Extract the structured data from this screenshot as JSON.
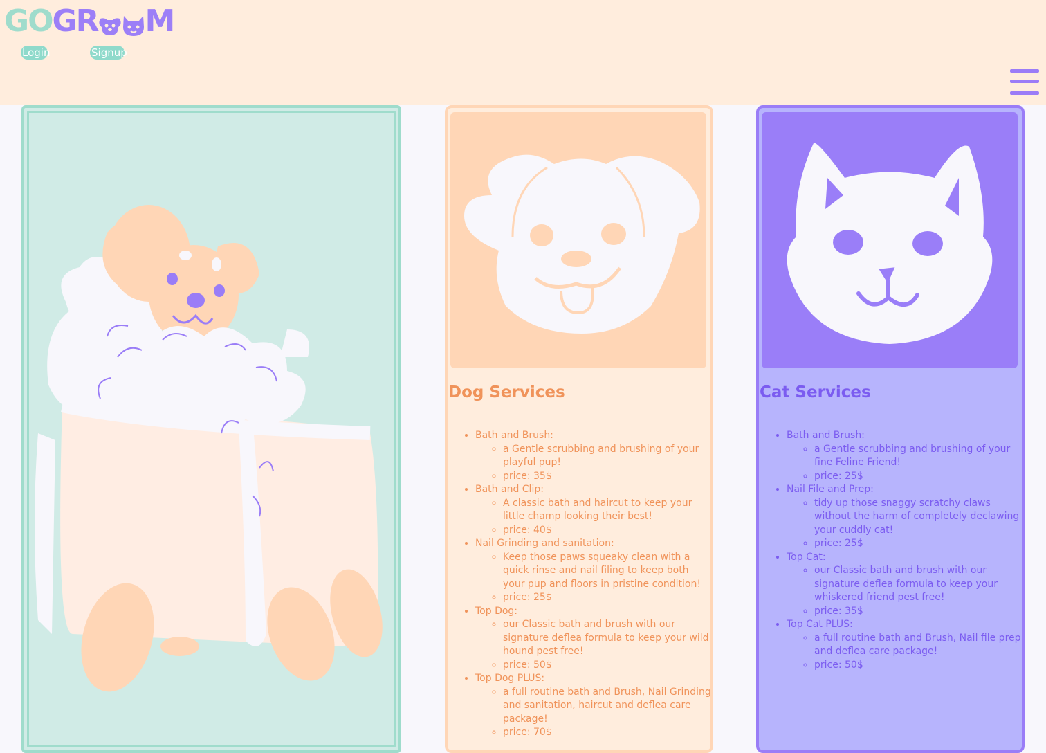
{
  "header": {
    "logo": {
      "part1": "GO",
      "part2": "GR",
      "part3": "M",
      "text": "GOGROOM"
    },
    "login_label": "Login",
    "signup_label": "Signup"
  },
  "dog": {
    "title": "Dog Services",
    "services": [
      {
        "name": "Bath and Brush:",
        "details": [
          "a Gentle scrubbing and brushing of your playful pup!",
          "price: 35$"
        ]
      },
      {
        "name": "Bath and Clip:",
        "details": [
          "A classic bath and haircut to keep your little champ looking their best!",
          "price: 40$"
        ]
      },
      {
        "name": "Nail Grinding and sanitation:",
        "details": [
          "Keep those paws squeaky clean with a quick rinse and nail filing to keep both your pup and floors in pristine condition!",
          "price: 25$"
        ]
      },
      {
        "name": "Top Dog:",
        "details": [
          "our Classic bath and brush with our signature deflea formula to keep your wild hound pest free!",
          "price: 50$"
        ]
      },
      {
        "name": "Top Dog PLUS:",
        "details": [
          "a full routine bath and Brush, Nail Grinding and sanitation, haircut and deflea care package!",
          "price: 70$"
        ]
      }
    ]
  },
  "cat": {
    "title": "Cat Services",
    "services": [
      {
        "name": "Bath and Brush:",
        "details": [
          "a Gentle scrubbing and brushing of your fine Feline Friend!",
          "price: 25$"
        ]
      },
      {
        "name": "Nail File and Prep:",
        "details": [
          "tidy up those snaggy scratchy claws without the harm of completely declawing your cuddly cat!",
          "price: 25$"
        ]
      },
      {
        "name": "Top Cat:",
        "details": [
          "our Classic bath and brush with our signature deflea formula to keep your whiskered friend pest free!",
          "price: 35$"
        ]
      },
      {
        "name": "Top Cat PLUS:",
        "details": [
          "a full routine bath and Brush, Nail file prep and deflea care package!",
          "price: 50$"
        ]
      }
    ]
  },
  "colors": {
    "mint": "#9fdccc",
    "peach": "#ffd6b6",
    "cream": "#ffeddd",
    "purple": "#9a7df7",
    "lavender": "#b7b4fd",
    "dog_text": "#f0935a",
    "cat_text": "#7b5cf0"
  },
  "icons": [
    "dog-face-icon",
    "cat-face-icon",
    "menu-icon",
    "bathing-dog-illustration"
  ]
}
